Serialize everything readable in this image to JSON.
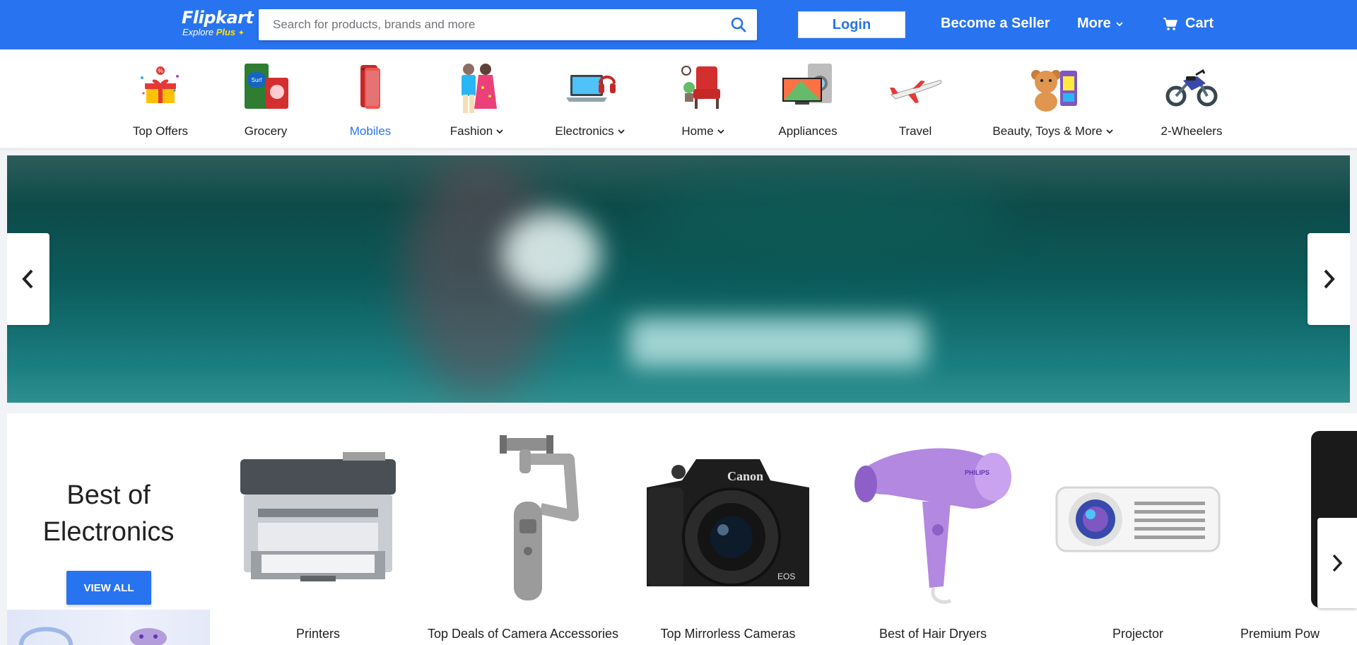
{
  "header": {
    "logo_main": "Flipkart",
    "logo_sub_explore": "Explore",
    "logo_sub_plus": "Plus",
    "search_placeholder": "Search for products, brands and more",
    "login_label": "Login",
    "seller_label": "Become a Seller",
    "more_label": "More",
    "cart_label": "Cart",
    "colors": {
      "brand_blue": "#2874f0",
      "logo_yellow": "#ffe500"
    }
  },
  "categories": [
    {
      "label": "Top Offers",
      "icon": "gift-offers-icon",
      "dropdown": false,
      "active": false
    },
    {
      "label": "Grocery",
      "icon": "grocery-icon",
      "dropdown": false,
      "active": false
    },
    {
      "label": "Mobiles",
      "icon": "mobile-phone-icon",
      "dropdown": false,
      "active": true
    },
    {
      "label": "Fashion",
      "icon": "fashion-icon",
      "dropdown": true,
      "active": false
    },
    {
      "label": "Electronics",
      "icon": "laptop-icon",
      "dropdown": true,
      "active": false
    },
    {
      "label": "Home",
      "icon": "home-furniture-icon",
      "dropdown": true,
      "active": false
    },
    {
      "label": "Appliances",
      "icon": "appliances-icon",
      "dropdown": false,
      "active": false
    },
    {
      "label": "Travel",
      "icon": "airplane-icon",
      "dropdown": false,
      "active": false
    },
    {
      "label": "Beauty, Toys & More",
      "icon": "teddy-bear-icon",
      "dropdown": true,
      "active": false
    },
    {
      "label": "2-Wheelers",
      "icon": "motorcycle-icon",
      "dropdown": false,
      "active": false
    }
  ],
  "banner": {
    "prev_icon": "chevron-left-icon",
    "next_icon": "chevron-right-icon"
  },
  "electronics_section": {
    "title_line1": "Best of",
    "title_line2": "Electronics",
    "view_all_label": "VIEW ALL",
    "products": [
      {
        "label": "Printers",
        "icon": "printer-icon"
      },
      {
        "label": "Top Deals of Camera Accessories",
        "icon": "gimbal-icon"
      },
      {
        "label": "Top Mirrorless Cameras",
        "icon": "camera-icon"
      },
      {
        "label": "Best of Hair Dryers",
        "icon": "hair-dryer-icon"
      },
      {
        "label": "Projector",
        "icon": "projector-icon"
      },
      {
        "label": "Premium Pow",
        "icon": "power-bank-icon"
      }
    ],
    "next_icon": "chevron-right-icon"
  }
}
